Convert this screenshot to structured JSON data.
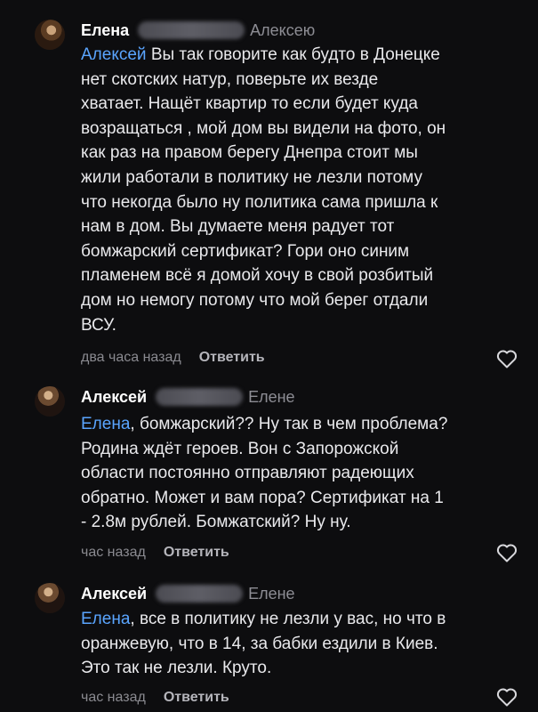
{
  "comments": [
    {
      "author": "Елена",
      "reply_to": "Алексею",
      "mention": "Алексей",
      "text": "Вы так говорите как будто в Донецке\nнет скотских натур, поверьте их везде\nхватает. Нащёт квартир то если будет куда\nвозращаться , мой дом вы видели на фото, он\nкак раз на правом берегу Днепра стоит мы\nжили работали в политику не лезли потому\nчто некогда было ну политика сама пришла к\nнам в дом. Вы думаете меня радует тот\nбомжарский сертификат? Гори оно синим\nпламенем всё я домой хочу в свой розбитый\nдом но немогу потому что мой берег отдали\nВСУ.",
      "time": "два часа назад",
      "reply_label": "Ответить",
      "like_icon": "heart-icon"
    },
    {
      "author": "Алексей",
      "reply_to": "Елене",
      "mention": "Елена",
      "text": ", бомжарский?? Ну так в чем проблема?\nРодина ждёт героев. Вон с Запорожской\nобласти постоянно отправляют радеющих\nобратно. Может и вам пора? Сертификат на 1\n- 2.8м рублей. Бомжатский? Ну ну.",
      "time": "час назад",
      "reply_label": "Ответить",
      "like_icon": "heart-icon"
    },
    {
      "author": "Алексей",
      "reply_to": "Елене",
      "mention": "Елена",
      "text": ", все в политику не лезли у вас, но что в\nоранжевую, что в 14, за бабки ездили в Киев.\nЭто так не лезли. Круто.",
      "time": "час назад",
      "reply_label": "Ответить",
      "like_icon": "heart-icon"
    }
  ]
}
